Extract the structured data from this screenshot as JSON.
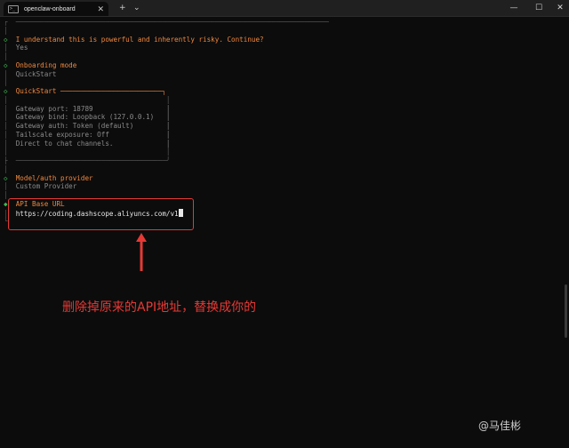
{
  "window": {
    "tab_title": "openclaw-onboard",
    "tab_icon_text": ">_",
    "tab_close": "✕",
    "new_tab": "+",
    "dropdown": "⌄",
    "minimize": "—",
    "maximize": "☐",
    "close": "✕"
  },
  "terminal": {
    "lines": [
      {
        "prefix": "┌",
        "text": "─────────────────────────────────────────────────────────────────────────────",
        "cls": "c-dim"
      },
      {
        "prefix": "│",
        "text": "",
        "cls": "c-dim"
      },
      {
        "prefix": "◇",
        "text": "I understand this is powerful and inherently risky. Continue?",
        "cls": "c-orange"
      },
      {
        "prefix": "│",
        "text": "Yes",
        "cls": "c-gray"
      },
      {
        "prefix": "│",
        "text": "",
        "cls": "c-dim"
      },
      {
        "prefix": "◇",
        "text": "Onboarding mode",
        "cls": "c-orange"
      },
      {
        "prefix": "│",
        "text": "QuickStart",
        "cls": "c-gray"
      },
      {
        "prefix": "│",
        "text": "",
        "cls": "c-dim"
      },
      {
        "prefix": "◇",
        "text": "QuickStart ─────────────────────────╮",
        "cls": "c-orange"
      },
      {
        "prefix": "│",
        "text": "                                     │",
        "cls": "c-dim"
      },
      {
        "prefix": "│",
        "text": "Gateway port: 18789                  │",
        "cls": "c-gray"
      },
      {
        "prefix": "│",
        "text": "Gateway bind: Loopback (127.0.0.1)   │",
        "cls": "c-gray"
      },
      {
        "prefix": "│",
        "text": "Gateway auth: Token (default)        │",
        "cls": "c-gray"
      },
      {
        "prefix": "│",
        "text": "Tailscale exposure: Off              │",
        "cls": "c-gray"
      },
      {
        "prefix": "│",
        "text": "Direct to chat channels.             │",
        "cls": "c-gray"
      },
      {
        "prefix": "│",
        "text": "                                     │",
        "cls": "c-dim"
      },
      {
        "prefix": "├",
        "text": "─────────────────────────────────────╯",
        "cls": "c-dim"
      },
      {
        "prefix": "│",
        "text": "",
        "cls": "c-dim"
      },
      {
        "prefix": "◇",
        "text": "Model/auth provider",
        "cls": "c-orange"
      },
      {
        "prefix": "│",
        "text": "Custom Provider",
        "cls": "c-gray"
      },
      {
        "prefix": "│",
        "text": "",
        "cls": "c-dim"
      },
      {
        "prefix": "◆",
        "text": "API Base URL",
        "cls": "c-orange"
      },
      {
        "prefix": "│",
        "text": "https://coding.dashscope.aliyuncs.com/v1",
        "cls": "c-white"
      },
      {
        "prefix": "└",
        "text": "",
        "cls": "c-dim"
      }
    ]
  },
  "annotation": {
    "text": "删除掉原来的API地址，替换成你的",
    "color": "#e53935"
  },
  "watermark": {
    "text": "@马佳彬"
  },
  "colors": {
    "green": "#3fb950",
    "orange": "#f0883e",
    "background": "#0c0c0c"
  }
}
